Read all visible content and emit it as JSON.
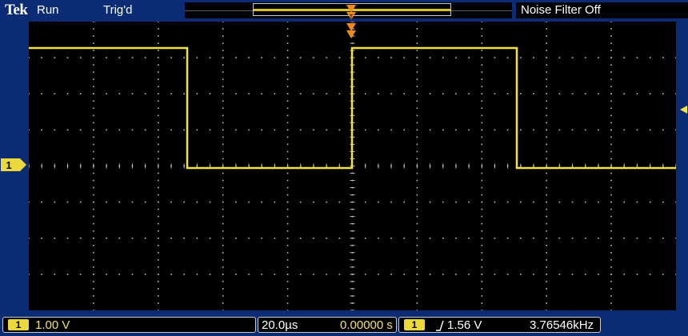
{
  "top_bar": {
    "logo": "Tek",
    "acquisition_state": "Run",
    "trigger_state": "Trig'd",
    "noise_filter": "Noise Filter Off"
  },
  "channel": {
    "number": "1",
    "marker_label": "1",
    "vertical_scale": "1.00 V",
    "color": "#f2e43a"
  },
  "horizontal": {
    "time_per_div": "20.0µs",
    "position": "0.00000 s"
  },
  "trigger": {
    "source": "1",
    "slope_icon": "rising-edge-icon",
    "level": "1.56 V",
    "frequency": "3.76546kHz",
    "marker_color": "#f08a1c"
  },
  "colors": {
    "background": "#0b2c74",
    "screen": "#000000",
    "grid": "#bdbdbd",
    "trace": "#f2e43a"
  }
}
